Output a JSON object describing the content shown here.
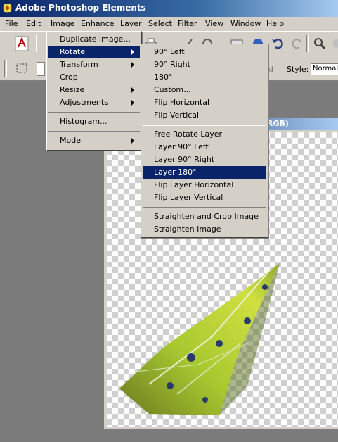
{
  "window": {
    "title": "Adobe Photoshop Elements"
  },
  "menubar": [
    "File",
    "Edit",
    "Image",
    "Enhance",
    "Layer",
    "Select",
    "Filter",
    "View",
    "Window",
    "Help"
  ],
  "image_menu": [
    {
      "label": "Duplicate Image...",
      "submenu": false
    },
    {
      "label": "Rotate",
      "submenu": true
    },
    {
      "label": "Transform",
      "submenu": true
    },
    {
      "label": "Crop",
      "submenu": false
    },
    {
      "label": "Resize",
      "submenu": true
    },
    {
      "label": "Adjustments",
      "submenu": true
    },
    {
      "label": "Histogram...",
      "submenu": false
    },
    {
      "label": "Mode",
      "submenu": true
    }
  ],
  "rotate_menu": [
    "90° Left",
    "90° Right",
    "180°",
    "Custom...",
    "Flip Horizontal",
    "Flip Vertical",
    "Free Rotate Layer",
    "Layer 90° Left",
    "Layer 90° Right",
    "Layer 180°",
    "Flip Layer Horizontal",
    "Flip Layer Vertical",
    "Straighten and Crop Image",
    "Straighten Image"
  ],
  "toolbar": {
    "style_label": "Style:",
    "style_value": "Normal",
    "partial_label": "d"
  },
  "document": {
    "title_fragment": "RGB)"
  },
  "colors": {
    "title_bar": "#0a246a",
    "menu_bg": "#d4d0c8",
    "highlight": "#0a246a"
  }
}
